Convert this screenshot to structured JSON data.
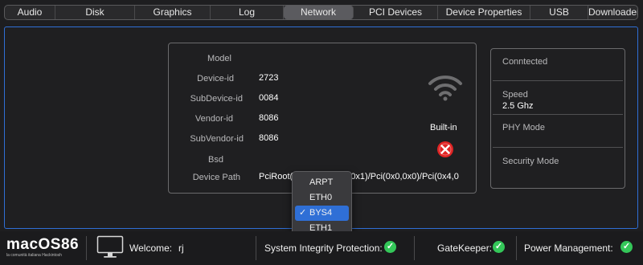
{
  "tabs": [
    {
      "label": "Audio",
      "active": false
    },
    {
      "label": "Disk",
      "active": false
    },
    {
      "label": "Graphics",
      "active": false
    },
    {
      "label": "Log",
      "active": false
    },
    {
      "label": "Network",
      "active": true
    },
    {
      "label": "PCI Devices",
      "active": false
    },
    {
      "label": "Device Properties",
      "active": false
    },
    {
      "label": "USB",
      "active": false
    },
    {
      "label": "Downloader",
      "active": false
    }
  ],
  "device": {
    "model_label": "Model",
    "device_id_label": "Device-id",
    "device_id": "2723",
    "subdevice_id_label": "SubDevice-id",
    "subdevice_id": "0084",
    "vendor_id_label": "Vendor-id",
    "vendor_id": "8086",
    "subvendor_id_label": "SubVendor-id",
    "subvendor_id": "8086",
    "bsd_label": "Bsd",
    "device_path_label": "Device Path",
    "device_path": "PciRoot(0x0)/Pci(0x1C,0x1)/Pci(0x0,0x0)/Pci(0x4,0",
    "builtin_label": "Built-in",
    "icon_wifi": "wifi-icon",
    "icon_builtin_status": "red-x-icon"
  },
  "status_panel": {
    "connected_label": "Conntected",
    "speed_label": "Speed",
    "speed_value": "2.5 Ghz",
    "phy_mode_label": "PHY Mode",
    "security_mode_label": "Security Mode"
  },
  "bsd_dropdown": {
    "options": [
      "ARPT",
      "ETH0",
      "BYS4",
      "ETH1"
    ],
    "selected": "BYS4"
  },
  "statusbar": {
    "logo_text": "macOS86",
    "logo_sub": "la comunità italiana Hackintosh",
    "welcome_label": "Welcome:",
    "user": "rj",
    "sip_label": "System Integrity Protection:",
    "gatekeeper_label": "GateKeeper:",
    "power_label": "Power Management:",
    "accent": "#2f6fd6",
    "ok_color": "#34c759"
  }
}
